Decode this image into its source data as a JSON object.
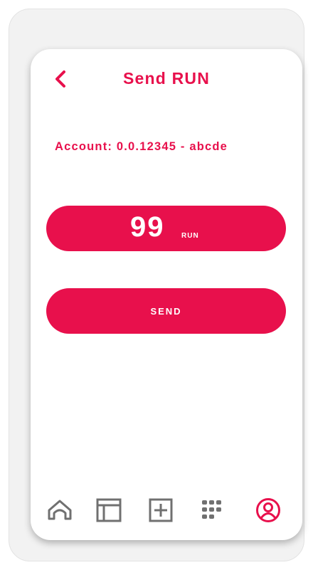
{
  "colors": {
    "accent": "#e8104c",
    "nav_inactive": "#707070",
    "background": "#ffffff",
    "frame": "#f2f2f2"
  },
  "header": {
    "back_icon": "chevron-left-icon",
    "title": "Send RUN"
  },
  "account": {
    "text": "Account: 0.0.12345 - abcde"
  },
  "amount": {
    "value": "99",
    "unit": "RUN"
  },
  "send_button": {
    "label": "SEND"
  },
  "bottom_nav": {
    "items": [
      {
        "icon": "home-icon",
        "active": false
      },
      {
        "icon": "browser-window-icon",
        "active": false
      },
      {
        "icon": "plus-square-icon",
        "active": false
      },
      {
        "icon": "apps-grid-icon",
        "active": false
      },
      {
        "icon": "profile-icon",
        "active": true
      }
    ]
  }
}
